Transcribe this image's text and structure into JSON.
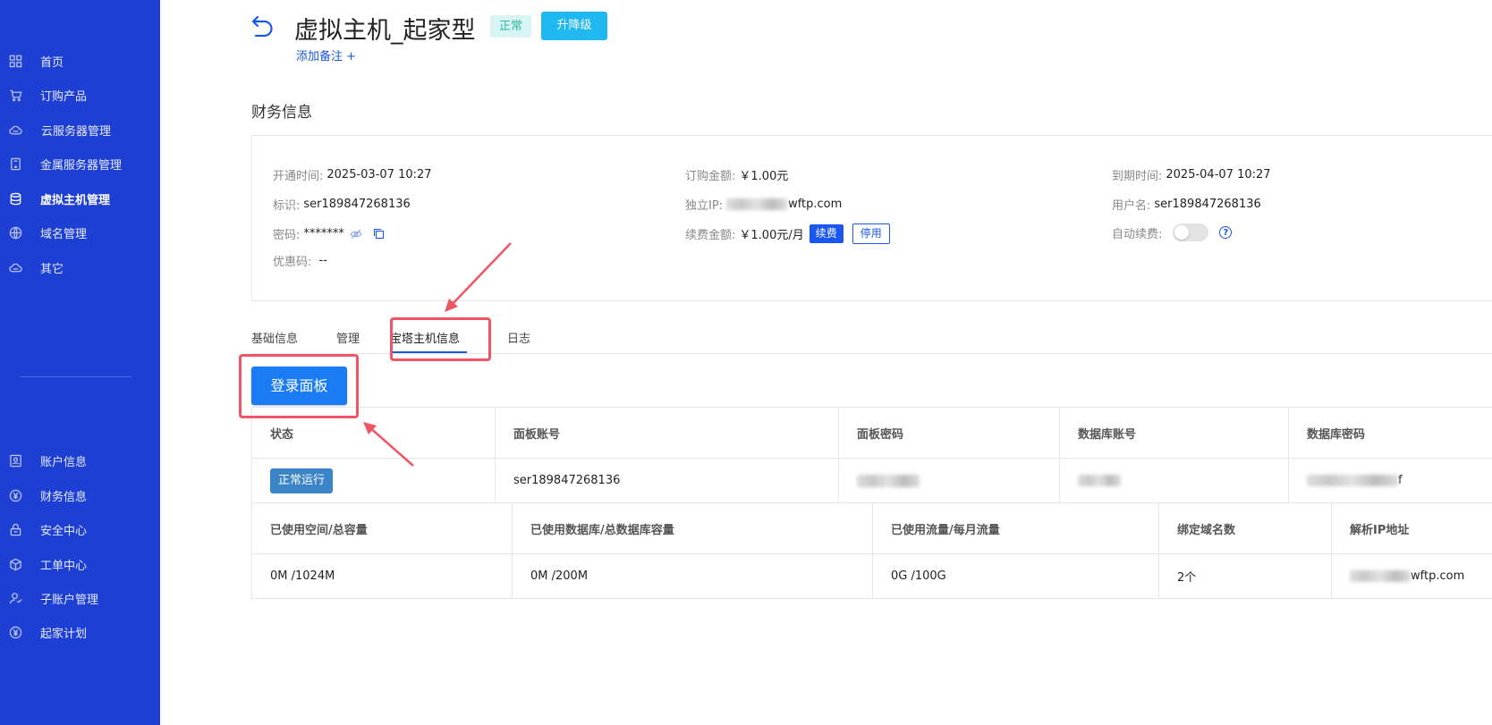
{
  "sidebar": {
    "items": [
      {
        "label": "首页",
        "icon": "grid-icon"
      },
      {
        "label": "订购产品",
        "icon": "cart-icon"
      },
      {
        "label": "云服务器管理",
        "icon": "cloud-icon"
      },
      {
        "label": "金属服务器管理",
        "icon": "server-icon"
      },
      {
        "label": "虚拟主机管理",
        "icon": "database-icon",
        "active": true
      },
      {
        "label": "域名管理",
        "icon": "globe-icon"
      },
      {
        "label": "其它",
        "icon": "cloud-icon"
      },
      {
        "label": "账户信息",
        "icon": "account-icon"
      },
      {
        "label": "财务信息",
        "icon": "yuan-icon"
      },
      {
        "label": "安全中心",
        "icon": "lock-icon"
      },
      {
        "label": "工单中心",
        "icon": "box-icon"
      },
      {
        "label": "子账户管理",
        "icon": "users-icon"
      },
      {
        "label": "起家计划",
        "icon": "yuan-icon"
      }
    ]
  },
  "header": {
    "title": "虚拟主机_起家型",
    "status": "正常",
    "upgrade_label": "升降级",
    "add_note": "添加备注 +"
  },
  "finance": {
    "section_title": "财务信息",
    "open_time_label": "开通时间:",
    "open_time": "2025-03-07 10:27",
    "order_amount_label": "订购金额:",
    "order_amount": "￥1.00元",
    "expire_label": "到期时间:",
    "expire_time": "2025-04-07 10:27",
    "id_label": "标识:",
    "id": "ser189847268136",
    "ip_label": "独立IP:",
    "ip_suffix": "wftp.com",
    "username_label": "用户名:",
    "username": "ser189847268136",
    "password_label": "密码:",
    "password": "*******",
    "renew_amount_label": "续费金额:",
    "renew_amount": "￥1.00元/月",
    "renew_button": "续费",
    "disable_button": "停用",
    "auto_renew_label": "自动续费:",
    "auto_renew_on": false,
    "coupon_label": "优惠码:",
    "coupon": "--"
  },
  "tabs": [
    {
      "label": "基础信息"
    },
    {
      "label": "管理"
    },
    {
      "label": "宝塔主机信息",
      "active": true
    },
    {
      "label": "日志"
    }
  ],
  "panel": {
    "login_label": "登录面板",
    "table1": {
      "headers": [
        "状态",
        "面板账号",
        "面板密码",
        "数据库账号",
        "数据库密码"
      ],
      "status": "正常运行",
      "panel_account": "ser189847268136",
      "db_password_suffix": "f"
    },
    "table2": {
      "headers": [
        "已使用空间/总容量",
        "已使用数据库/总数据库容量",
        "已使用流量/每月流量",
        "绑定域名数",
        "解析IP地址"
      ],
      "row": [
        "0M /1024M",
        "0M /200M",
        "0G /100G",
        "2个",
        "wftp.com"
      ]
    }
  },
  "colors": {
    "sidebar": "#1e3fd4",
    "accent": "#1a56f0",
    "highlight": "#f05563"
  }
}
